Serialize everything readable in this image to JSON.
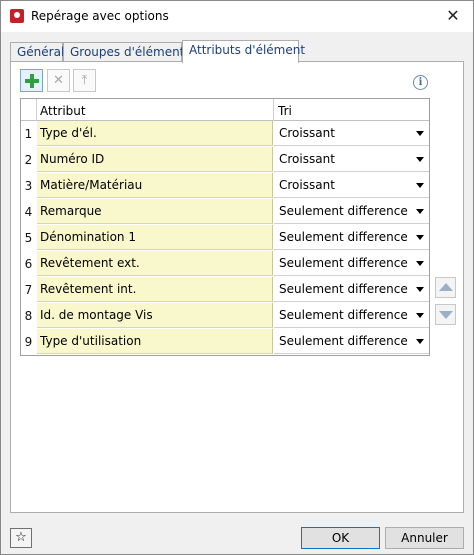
{
  "window": {
    "title": "Repérage avec options"
  },
  "tabs": [
    {
      "label": "Général"
    },
    {
      "label": "Groupes d'éléments"
    },
    {
      "label": "Attributs d'élément"
    }
  ],
  "grid": {
    "headers": {
      "attribut": "Attribut",
      "tri": "Tri"
    },
    "rows": [
      {
        "num": "1",
        "attribut": "Type d'él.",
        "tri": "Croissant"
      },
      {
        "num": "2",
        "attribut": "Numéro ID",
        "tri": "Croissant"
      },
      {
        "num": "3",
        "attribut": "Matière/Matériau",
        "tri": "Croissant"
      },
      {
        "num": "4",
        "attribut": "Remarque",
        "tri": "Seulement difference"
      },
      {
        "num": "5",
        "attribut": "Dénomination 1",
        "tri": "Seulement difference"
      },
      {
        "num": "6",
        "attribut": "Revêtement ext.",
        "tri": "Seulement difference"
      },
      {
        "num": "7",
        "attribut": "Revêtement int.",
        "tri": "Seulement difference"
      },
      {
        "num": "8",
        "attribut": "Id. de montage Vis",
        "tri": "Seulement difference"
      },
      {
        "num": "9",
        "attribut": "Type d'utilisation",
        "tri": "Seulement difference"
      }
    ]
  },
  "buttons": {
    "ok": "OK",
    "cancel": "Annuler"
  },
  "icons": {
    "add": "plus-icon",
    "delete": "x-icon",
    "top": "move-top-icon",
    "info": "info-icon",
    "up": "arrow-up-icon",
    "down": "arrow-down-icon",
    "favorite": "star-icon",
    "close": "close-icon",
    "app": "app-logo-icon"
  }
}
